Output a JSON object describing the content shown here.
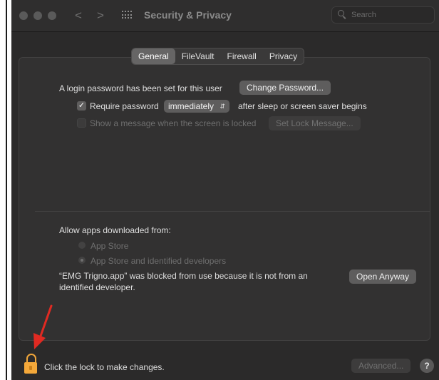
{
  "window": {
    "title": "Security & Privacy"
  },
  "toolbar": {
    "back": "<",
    "forward": ">"
  },
  "search": {
    "placeholder": "Search"
  },
  "tabs": [
    {
      "label": "General",
      "active": true
    },
    {
      "label": "FileVault",
      "active": false
    },
    {
      "label": "Firewall",
      "active": false
    },
    {
      "label": "Privacy",
      "active": false
    }
  ],
  "general": {
    "login_text": "A login password has been set for this user",
    "change_password_button": "Change Password...",
    "require_password_label": "Require password",
    "require_password_checked": true,
    "require_password_value": "immediately",
    "after_sleep_text": "after sleep or screen saver begins",
    "show_message_label": "Show a message when the screen is locked",
    "show_message_checked": false,
    "set_lock_message_button": "Set Lock Message..."
  },
  "apps": {
    "heading": "Allow apps downloaded from:",
    "options": [
      {
        "label": "App Store",
        "selected": false
      },
      {
        "label": "App Store and identified developers",
        "selected": true
      }
    ],
    "blocked_line1": "“EMG Trigno.app” was blocked from use because it is not from an",
    "blocked_line2": "identified developer.",
    "open_anyway_button": "Open Anyway"
  },
  "footer": {
    "lock_text": "Click the lock to make changes.",
    "advanced_button": "Advanced...",
    "help_button": "?"
  },
  "colors": {
    "lock": "#f4a83a",
    "window_bg": "#2b2a2a",
    "panel_bg": "#323131"
  }
}
